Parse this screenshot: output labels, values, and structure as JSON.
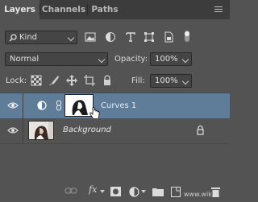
{
  "tabs": [
    "Layers",
    "Channels",
    "Paths"
  ],
  "filter": {
    "label": "Kind"
  },
  "blend_mode": {
    "value": "Normal"
  },
  "opacity": {
    "label": "Opacity:",
    "value": "100%"
  },
  "lock": {
    "label": "Lock:"
  },
  "fill": {
    "label": "Fill:",
    "value": "100%"
  },
  "layers": [
    {
      "name": "Curves 1",
      "selected": true
    },
    {
      "name": "Background",
      "locked": true
    }
  ],
  "icons": {
    "menu": "panel-menu-icon",
    "filter_types": [
      "pixel-filter-icon",
      "adjustment-filter-icon",
      "type-filter-icon",
      "shape-filter-icon",
      "smart-object-filter-icon"
    ],
    "lock_types": [
      "lock-transparent-icon",
      "lock-image-icon",
      "lock-position-icon",
      "lock-artboard-icon",
      "lock-all-icon"
    ],
    "bottom": [
      "link-layers-icon",
      "fx-icon",
      "add-mask-icon",
      "new-adjustment-icon",
      "new-group-icon",
      "new-layer-icon",
      "delete-icon"
    ]
  },
  "watermark": "www.wiki...",
  "colors": {
    "selected_row": "#5f7d99",
    "panel": "#535353",
    "tabbar": "#3c3c3c"
  }
}
